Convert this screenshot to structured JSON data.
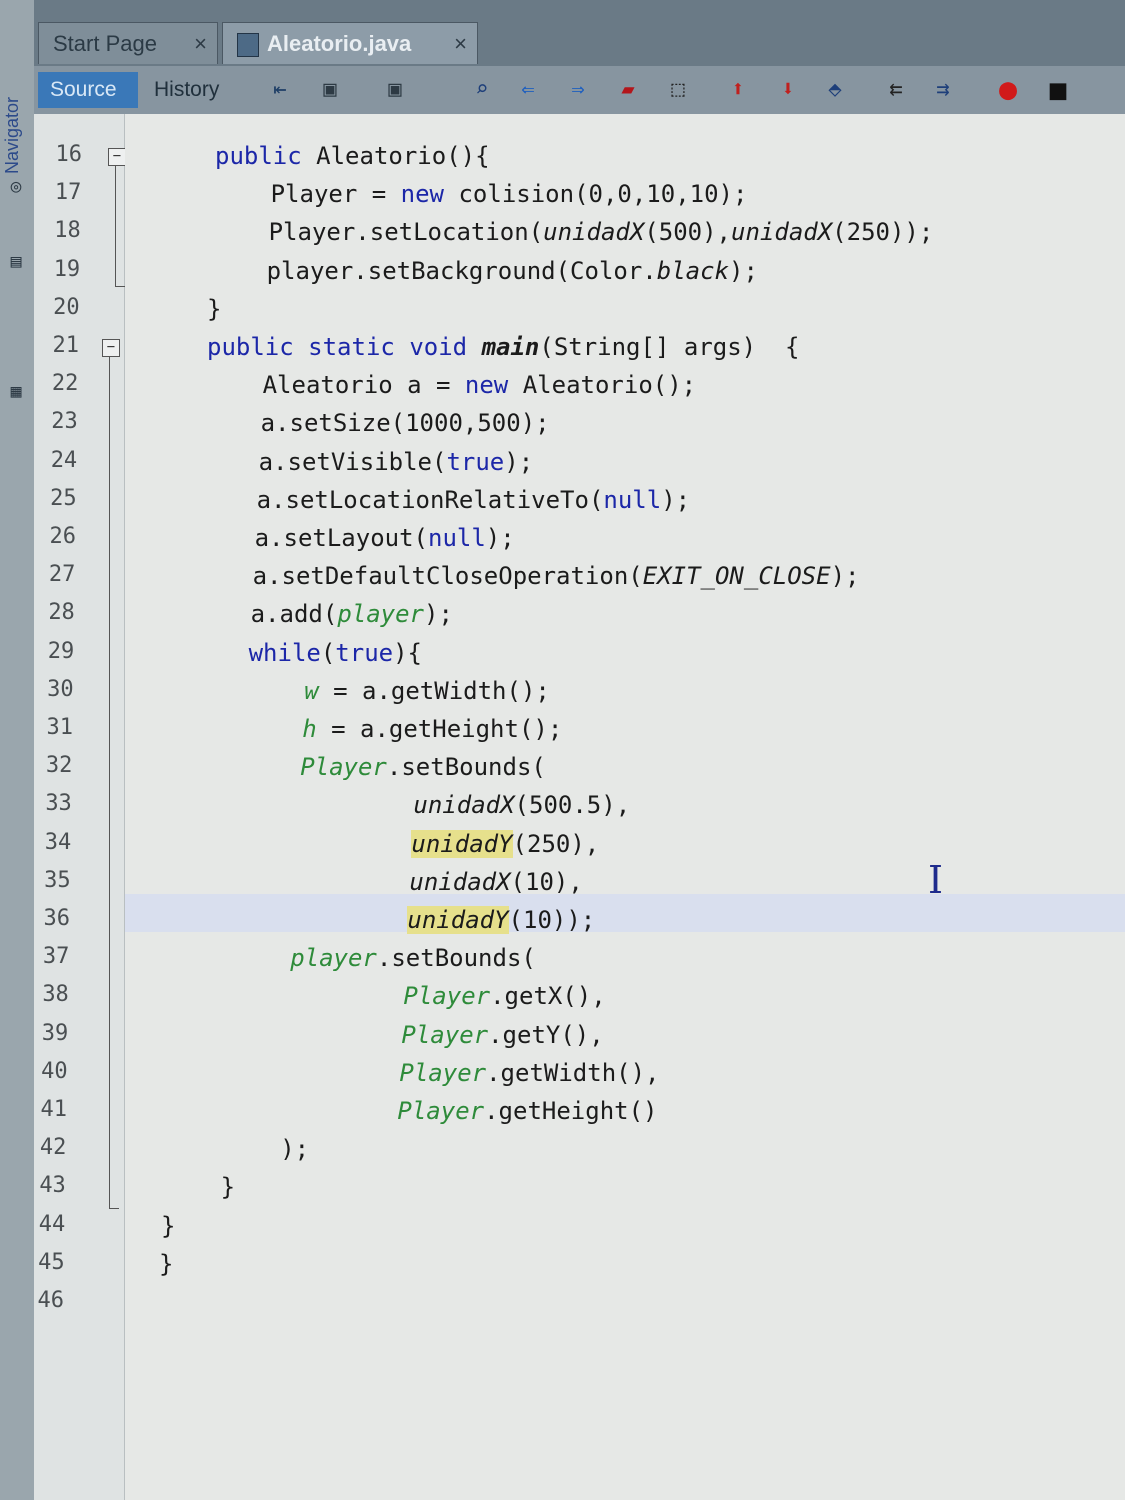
{
  "sidebar": {
    "navigator_label": "Navigator"
  },
  "tabs": [
    {
      "label": "Start Page",
      "active": false,
      "close": "×"
    },
    {
      "label": "Aleatorio.java",
      "active": true,
      "close": "×"
    }
  ],
  "toolbar": {
    "source_label": "Source",
    "history_label": "History",
    "icons": [
      "last-edit-icon",
      "back-icon",
      "forward-icon",
      "find-icon",
      "find-previous-icon",
      "find-next-icon",
      "toggle-highlight-icon",
      "toggle-rectangular-selection-icon",
      "previous-bookmark-icon",
      "next-bookmark-icon",
      "toggle-bookmark-icon",
      "shift-left-icon",
      "shift-right-icon",
      "start-macro-icon",
      "stop-macro-icon"
    ]
  },
  "editor": {
    "line_numbers": [
      "16",
      "17",
      "18",
      "19",
      "20",
      "21",
      "22",
      "23",
      "24",
      "25",
      "26",
      "27",
      "28",
      "29",
      "30",
      "31",
      "32",
      "33",
      "34",
      "35",
      "36",
      "37",
      "38",
      "39",
      "40",
      "41",
      "42",
      "43",
      "44",
      "45",
      "46"
    ],
    "lines": [
      {
        "indent": "",
        "text": "public Aleatorio(){"
      },
      {
        "indent": "    ",
        "text": "Player = new colision(0,0,10,10);"
      },
      {
        "indent": "    ",
        "text": "Player.setLocation(unidadX(500),unidadX(250));"
      },
      {
        "indent": "    ",
        "text": "player.setBackground(Color.black);"
      },
      {
        "indent": "",
        "text": "}"
      },
      {
        "indent": "",
        "text": "public static void main(String[] args)  {"
      },
      {
        "indent": "    ",
        "text": "Aleatorio a = new Aleatorio();"
      },
      {
        "indent": "    ",
        "text": "a.setSize(1000,500);"
      },
      {
        "indent": "    ",
        "text": "a.setVisible(true);"
      },
      {
        "indent": "    ",
        "text": "a.setLocationRelativeTo(null);"
      },
      {
        "indent": "    ",
        "text": "a.setLayout(null);"
      },
      {
        "indent": "    ",
        "text": "a.setDefaultCloseOperation(EXIT_ON_CLOSE);"
      },
      {
        "indent": "    ",
        "text": "a.add(player);"
      },
      {
        "indent": "    ",
        "text": "while(true){"
      },
      {
        "indent": "        ",
        "text": "w = a.getWidth();"
      },
      {
        "indent": "        ",
        "text": "h = a.getHeight();"
      },
      {
        "indent": "        ",
        "text": "Player.setBounds("
      },
      {
        "indent": "                ",
        "text": "unidadX(500.5),"
      },
      {
        "indent": "                ",
        "text": "unidadY(250),"
      },
      {
        "indent": "                ",
        "text": "unidadX(10),"
      },
      {
        "indent": "                ",
        "text": "unidadY(10));"
      },
      {
        "indent": "        ",
        "text": "player.setBounds("
      },
      {
        "indent": "                ",
        "text": "Player.getX(),"
      },
      {
        "indent": "                ",
        "text": "Player.getY(),"
      },
      {
        "indent": "                ",
        "text": "Player.getWidth(),"
      },
      {
        "indent": "                ",
        "text": "Player.getHeight()"
      },
      {
        "indent": "        ",
        "text": ");"
      },
      {
        "indent": "    ",
        "text": "}"
      },
      {
        "indent": "",
        "text": "}"
      },
      {
        "indent": "",
        "text": "}"
      },
      {
        "indent": "",
        "text": ""
      }
    ]
  },
  "colors": {
    "keyword": "#1c27a8",
    "field": "#2e8b3a",
    "highlight": "#e6e08c",
    "current_line": "#d9dfee"
  }
}
